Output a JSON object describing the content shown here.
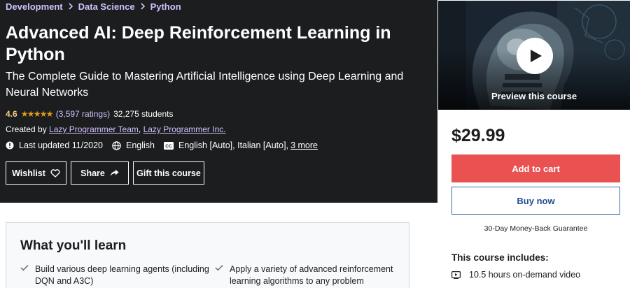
{
  "breadcrumb": [
    "Development",
    "Data Science",
    "Python"
  ],
  "course": {
    "title": "Advanced AI: Deep Reinforcement Learning in Python",
    "subtitle": "The Complete Guide to Mastering Artificial Intelligence using Deep Learning and Neural Networks",
    "rating": "4.6",
    "rating_value": 4.6,
    "ratings_count": "(3,597 ratings)",
    "students": "32,275 students",
    "created_by_label": "Created by",
    "instructors": [
      "Lazy Programmer Team",
      "Lazy Programmer Inc."
    ],
    "last_updated": "Last updated 11/2020",
    "language": "English",
    "captions": "English [Auto], Italian [Auto],",
    "more_link": "3 more"
  },
  "actions": {
    "wishlist": "Wishlist",
    "share": "Share",
    "gift": "Gift this course"
  },
  "sidebar": {
    "preview_label": "Preview this course",
    "price": "$29.99",
    "add_to_cart": "Add to cart",
    "buy_now": "Buy now",
    "guarantee": "30-Day Money-Back Guarantee",
    "includes_title": "This course includes:",
    "includes": [
      "10.5 hours on-demand video"
    ]
  },
  "learn": {
    "title": "What you'll learn",
    "items": [
      "Build various deep learning agents (including DQN and A3C)",
      "Apply a variety of advanced reinforcement learning algorithms to any problem"
    ]
  },
  "colors": {
    "hero_bg": "#1c1d1f",
    "link_purple": "#cec0fc",
    "rating_gold": "#f3ca8c",
    "star": "#e59819",
    "cart_red": "#ea5252",
    "buy_blue": "#1f4e8c"
  },
  "icons": [
    "chevron-right-icon",
    "star-icon",
    "alert-badge-icon",
    "globe-icon",
    "closed-captions-icon",
    "heart-icon",
    "share-arrow-icon",
    "play-icon",
    "check-icon",
    "video-icon"
  ]
}
